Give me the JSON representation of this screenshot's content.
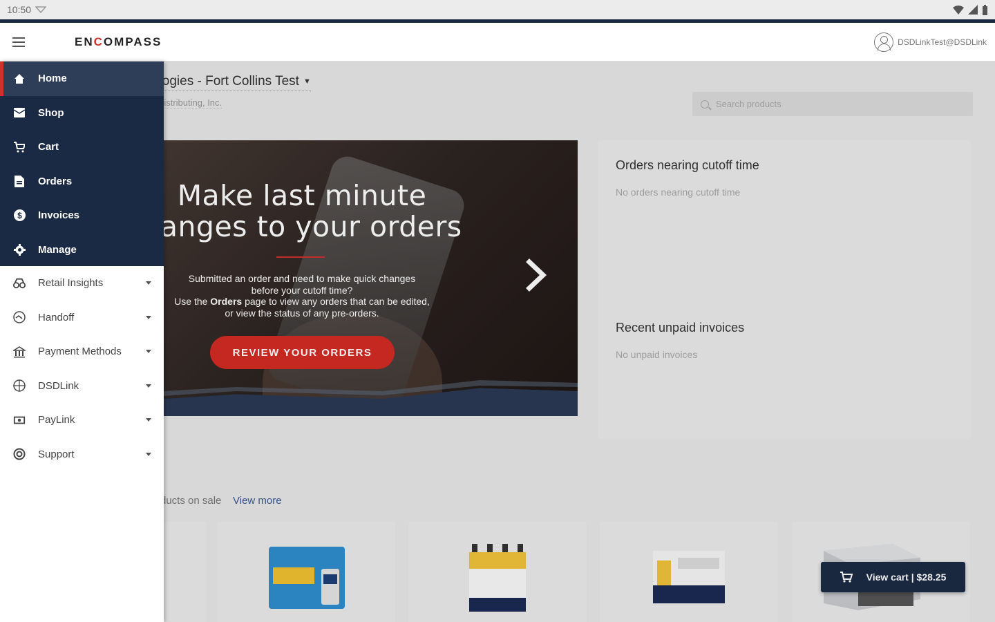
{
  "status_bar": {
    "time": "10:50"
  },
  "app_bar": {
    "logo_prefix": "EN",
    "logo_c": "C",
    "logo_suffix": "OMPASS",
    "user_email": "DSDLinkTest@DSDLink"
  },
  "location": {
    "store_name": "ologies - Fort Collins Test",
    "distributor": "r Distributing, Inc."
  },
  "search": {
    "placeholder": "Search products"
  },
  "banner": {
    "heading_line1": "Make last minute",
    "heading_line2": "hanges to your orders",
    "desc_line1": "Submitted an order and need to make quick changes",
    "desc_line2": "before your cutoff time?",
    "desc_line3_prefix": "Use the ",
    "desc_line3_bold": "Orders",
    "desc_line3_suffix": " page to view any orders that can be edited,",
    "desc_line4": "or view the status of any pre-orders.",
    "cta": "REVIEW YOUR ORDERS"
  },
  "panel": {
    "cutoff_title": "Orders nearing cutoff time",
    "cutoff_empty": "No orders nearing cutoff time",
    "invoices_title": "Recent unpaid invoices",
    "invoices_empty": "No unpaid invoices"
  },
  "products": {
    "section_label": "ducts on sale",
    "view_more": "View more"
  },
  "cart": {
    "label": "View cart | $28.25"
  },
  "drawer": {
    "primary": [
      {
        "label": "Home",
        "icon": "home-icon"
      },
      {
        "label": "Shop",
        "icon": "shop-icon"
      },
      {
        "label": "Cart",
        "icon": "cart-icon"
      },
      {
        "label": "Orders",
        "icon": "orders-icon"
      },
      {
        "label": "Invoices",
        "icon": "invoices-icon"
      },
      {
        "label": "Manage",
        "icon": "gear-icon"
      }
    ],
    "secondary": [
      {
        "label": "Retail Insights",
        "icon": "insights-icon"
      },
      {
        "label": "Handoff",
        "icon": "handoff-icon"
      },
      {
        "label": "Payment Methods",
        "icon": "payment-icon"
      },
      {
        "label": "DSDLink",
        "icon": "dsdlink-icon"
      },
      {
        "label": "PayLink",
        "icon": "paylink-icon"
      },
      {
        "label": "Support",
        "icon": "support-icon"
      }
    ]
  },
  "colors": {
    "navy": "#1b2a44",
    "accent_red": "#d0312d",
    "link_blue": "#3a5a95"
  }
}
